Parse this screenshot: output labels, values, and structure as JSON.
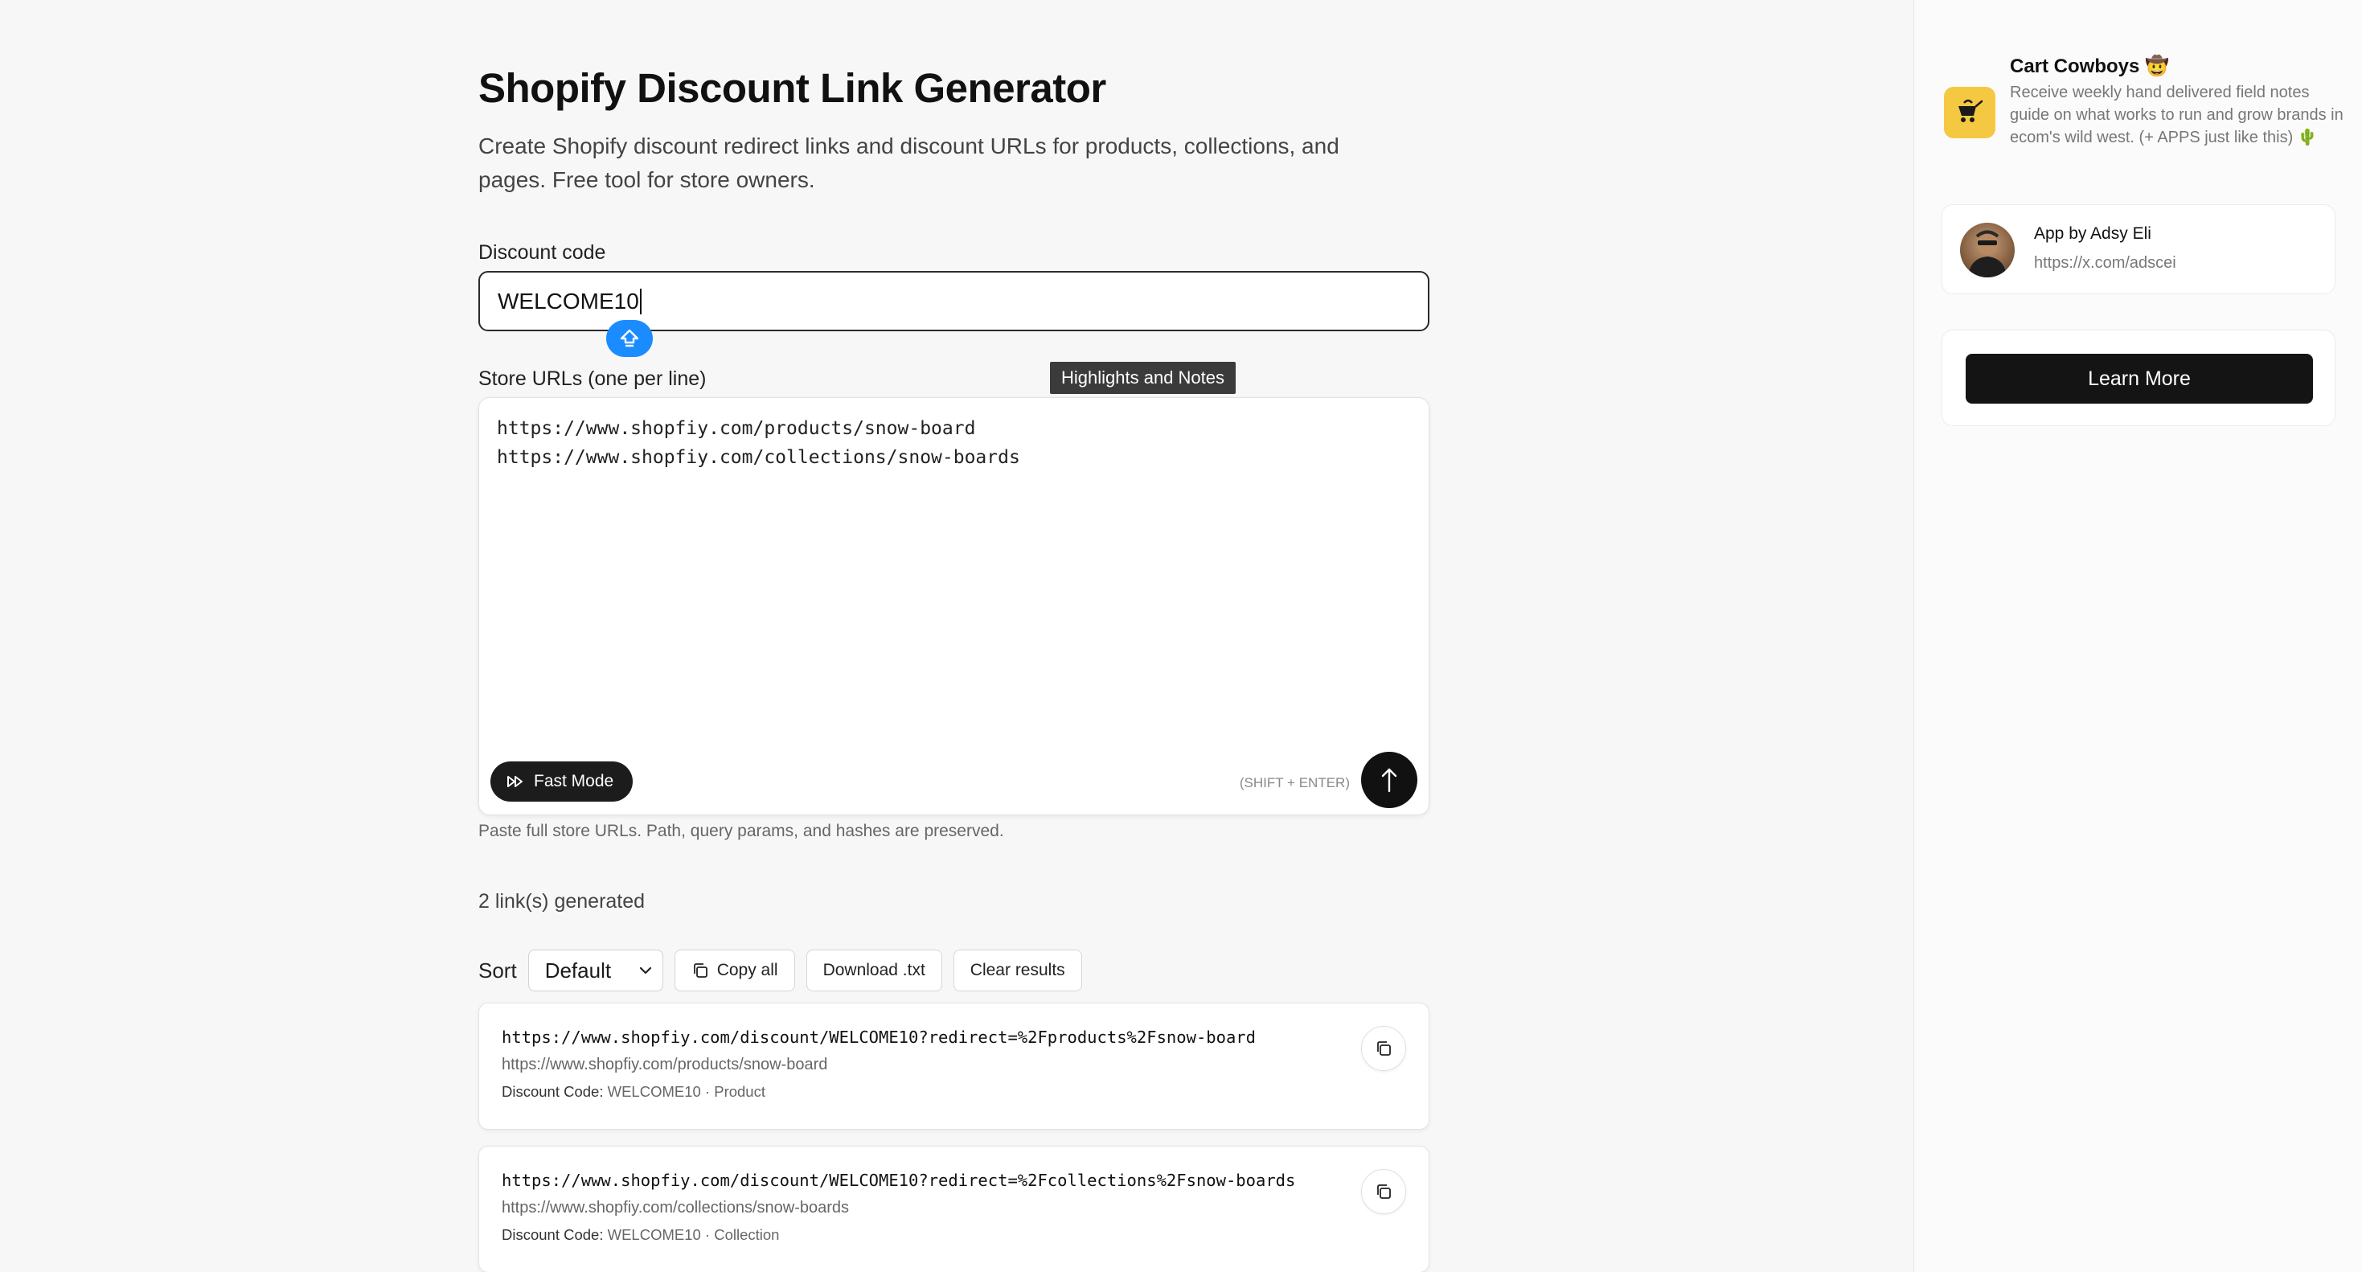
{
  "page": {
    "title": "Shopify Discount Link Generator",
    "subtitle": "Create Shopify discount redirect links and discount URLs for products, collections, and pages. Free tool for store owners."
  },
  "form": {
    "discount_label": "Discount code",
    "discount_value": "WELCOME10",
    "urls_label": "Store URLs (one per line)",
    "urls_value": "https://www.shopfiy.com/products/snow-board\nhttps://www.shopfiy.com/collections/snow-boards",
    "tooltip": "Highlights and Notes",
    "fast_mode_label": "Fast Mode",
    "shift_hint": "(SHIFT + ENTER)",
    "hint": "Paste full store URLs. Path, query params, and hashes are preserved."
  },
  "results": {
    "count_text": "2 link(s) generated",
    "sort_label": "Sort",
    "sort_selected": "Default",
    "copy_all_label": "Copy all",
    "download_label": "Download .txt",
    "clear_label": "Clear results",
    "items": [
      {
        "link": "https://www.shopfiy.com/discount/WELCOME10?redirect=%2Fproducts%2Fsnow-board",
        "source": "https://www.shopfiy.com/products/snow-board",
        "meta_key": "Discount Code:",
        "meta_value": "WELCOME10 · Product"
      },
      {
        "link": "https://www.shopfiy.com/discount/WELCOME10?redirect=%2Fcollections%2Fsnow-boards",
        "source": "https://www.shopfiy.com/collections/snow-boards",
        "meta_key": "Discount Code:",
        "meta_value": "WELCOME10 · Collection"
      }
    ]
  },
  "sidebar": {
    "promo_title": "Cart Cowboys 🤠",
    "promo_desc": "Receive weekly hand delivered field notes guide on what works to run and grow brands in ecom's wild west. (+ APPS just like this) 🌵",
    "author_name": "App by Adsy Eli",
    "author_url": "https://x.com/adscei",
    "learn_more_label": "Learn More"
  },
  "colors": {
    "accent_blue": "#1a8cff",
    "dark_button": "#141414",
    "promo_yellow": "#f5c842"
  },
  "icons": {
    "drag_handle": "home-arrow-icon",
    "fast_mode": "fast-forward-icon",
    "send": "arrow-up-icon",
    "copy": "copy-icon",
    "chevron": "chevron-down-icon"
  }
}
